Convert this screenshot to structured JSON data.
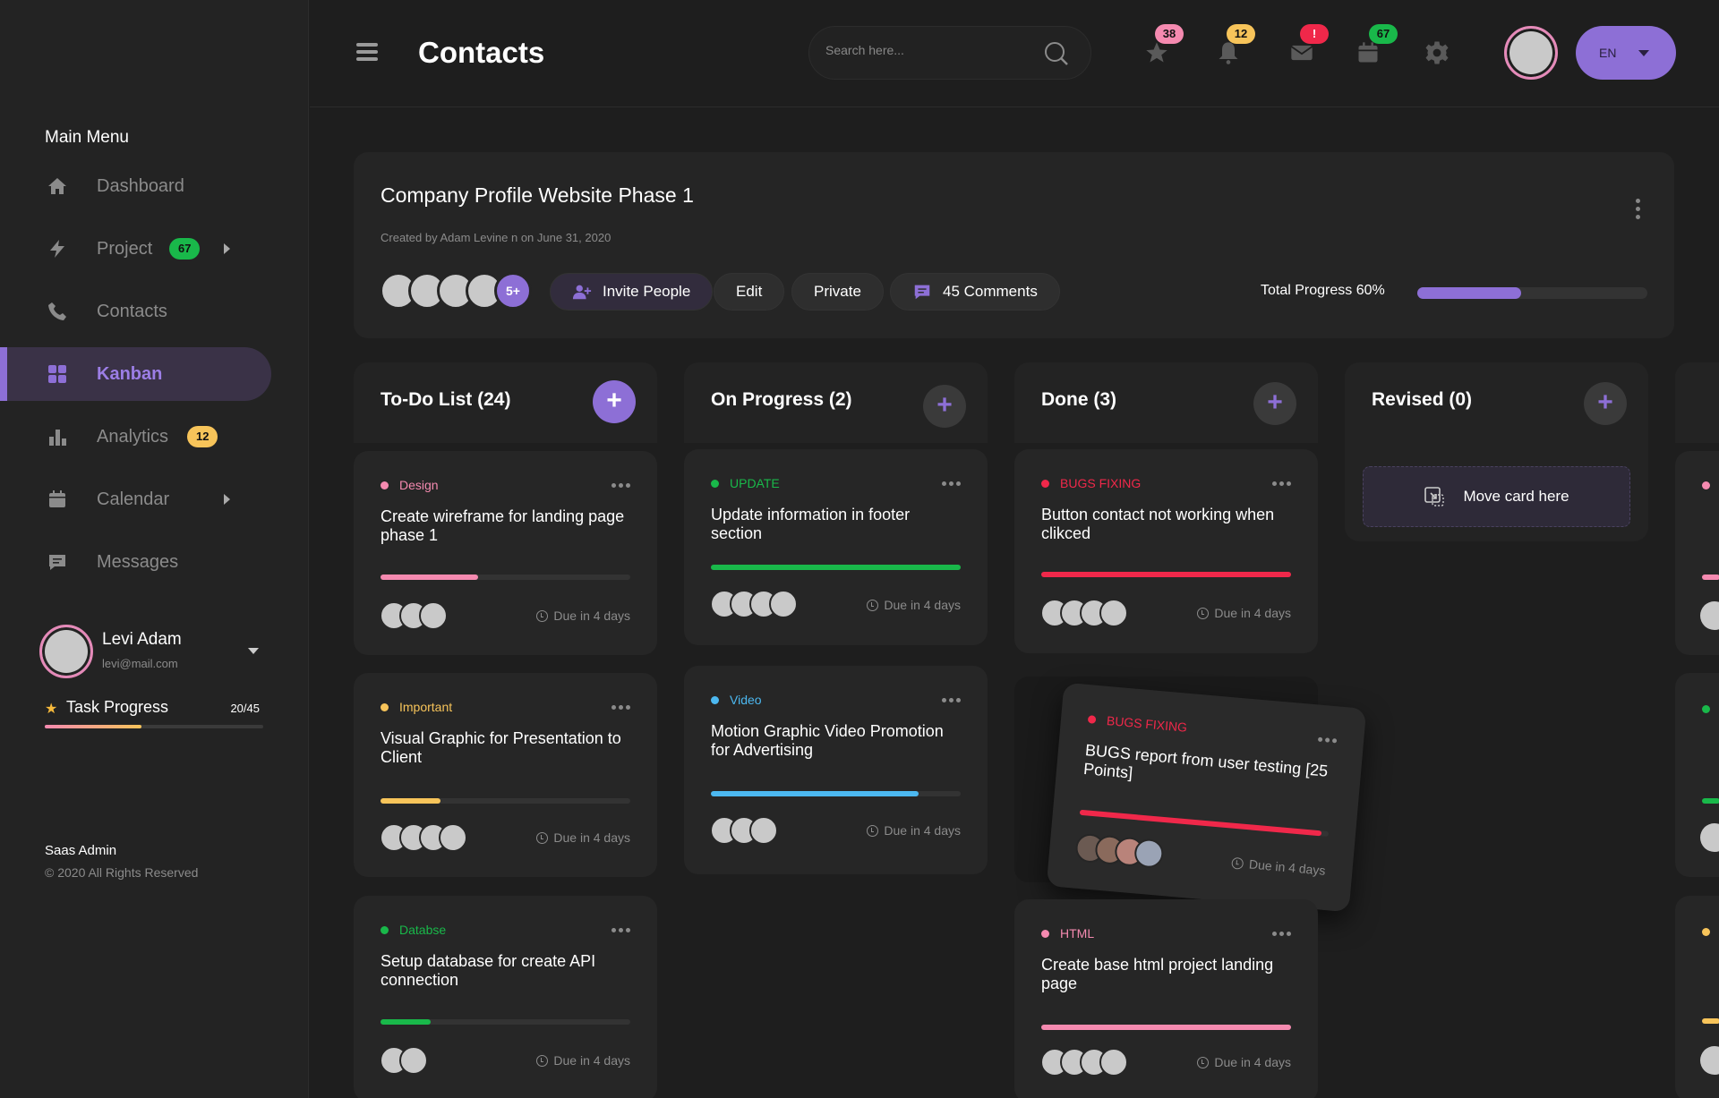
{
  "sidebar": {
    "menu_title": "Main Menu",
    "items": [
      {
        "label": "Dashboard"
      },
      {
        "label": "Project",
        "badge": "67"
      },
      {
        "label": "Contacts"
      },
      {
        "label": "Kanban"
      },
      {
        "label": "Analytics",
        "badge": "12"
      },
      {
        "label": "Calendar"
      },
      {
        "label": "Messages"
      }
    ],
    "user": {
      "name": "Levi Adam",
      "email": "levi@mail.com"
    },
    "task_progress": {
      "label": "Task Progress",
      "count": "20/45",
      "value": 0.444
    },
    "footer": {
      "brand": "Saas Admin",
      "copyright": "© 2020 All Rights Reserved"
    }
  },
  "header": {
    "title": "Contacts",
    "search_placeholder": "Search here...",
    "badges": {
      "favorites": "38",
      "notifications": "12",
      "messages": "!",
      "calendar": "67"
    },
    "language": "EN"
  },
  "project": {
    "title": "Company Profile Website Phase 1",
    "meta": "Created by Adam Levine n on June 31, 2020",
    "more_members": "5+",
    "invite_label": "Invite People",
    "edit_label": "Edit",
    "private_label": "Private",
    "comments_label": "45 Comments",
    "progress_label": "Total Progress 60%",
    "progress_value": 0.45
  },
  "columns": [
    {
      "title": "To-Do List (24)"
    },
    {
      "title": "On Progress (2)"
    },
    {
      "title": "Done (3)"
    },
    {
      "title": "Revised (0)"
    }
  ],
  "cards": {
    "todo": [
      {
        "tag": "Design",
        "title": "Create wireframe for landing page phase 1",
        "progress": 0.39,
        "due": "Due in 4 days"
      },
      {
        "tag": "Important",
        "title": "Visual Graphic for Presentation to Client",
        "progress": 0.24,
        "due": "Due in 4 days"
      },
      {
        "tag": "Databse",
        "title": "Setup database for create API connection",
        "progress": 0.2,
        "due": "Due in 4 days"
      }
    ],
    "progress": [
      {
        "tag": "UPDATE",
        "title": "Update information in footer section",
        "progress": 1.0,
        "due": "Due in 4 days"
      },
      {
        "tag": "Video",
        "title": "Motion Graphic Video Promotion for Advertising",
        "progress": 0.83,
        "due": "Due in 4 days"
      }
    ],
    "done": [
      {
        "tag": "BUGS FIXING",
        "title": "Button contact not working when clikced",
        "progress": 1.0,
        "due": "Due in 4 days"
      },
      {
        "tag": "BUGS FIXING",
        "title": "BUGS report from user testing [25 Points]",
        "progress": 0.97,
        "due": "Due in 4 days"
      },
      {
        "tag": "HTML",
        "title": "Create base html project landing page",
        "progress": 1.0,
        "due": "Due in 4 days"
      }
    ],
    "revised": {
      "move_label": "Move card here"
    }
  },
  "colors": {
    "accent": "#8d6fd6",
    "pink": "#f58ab0",
    "yellow": "#f7c45a",
    "green": "#19b84a",
    "red": "#f0284a",
    "blue": "#4cb8f0"
  }
}
